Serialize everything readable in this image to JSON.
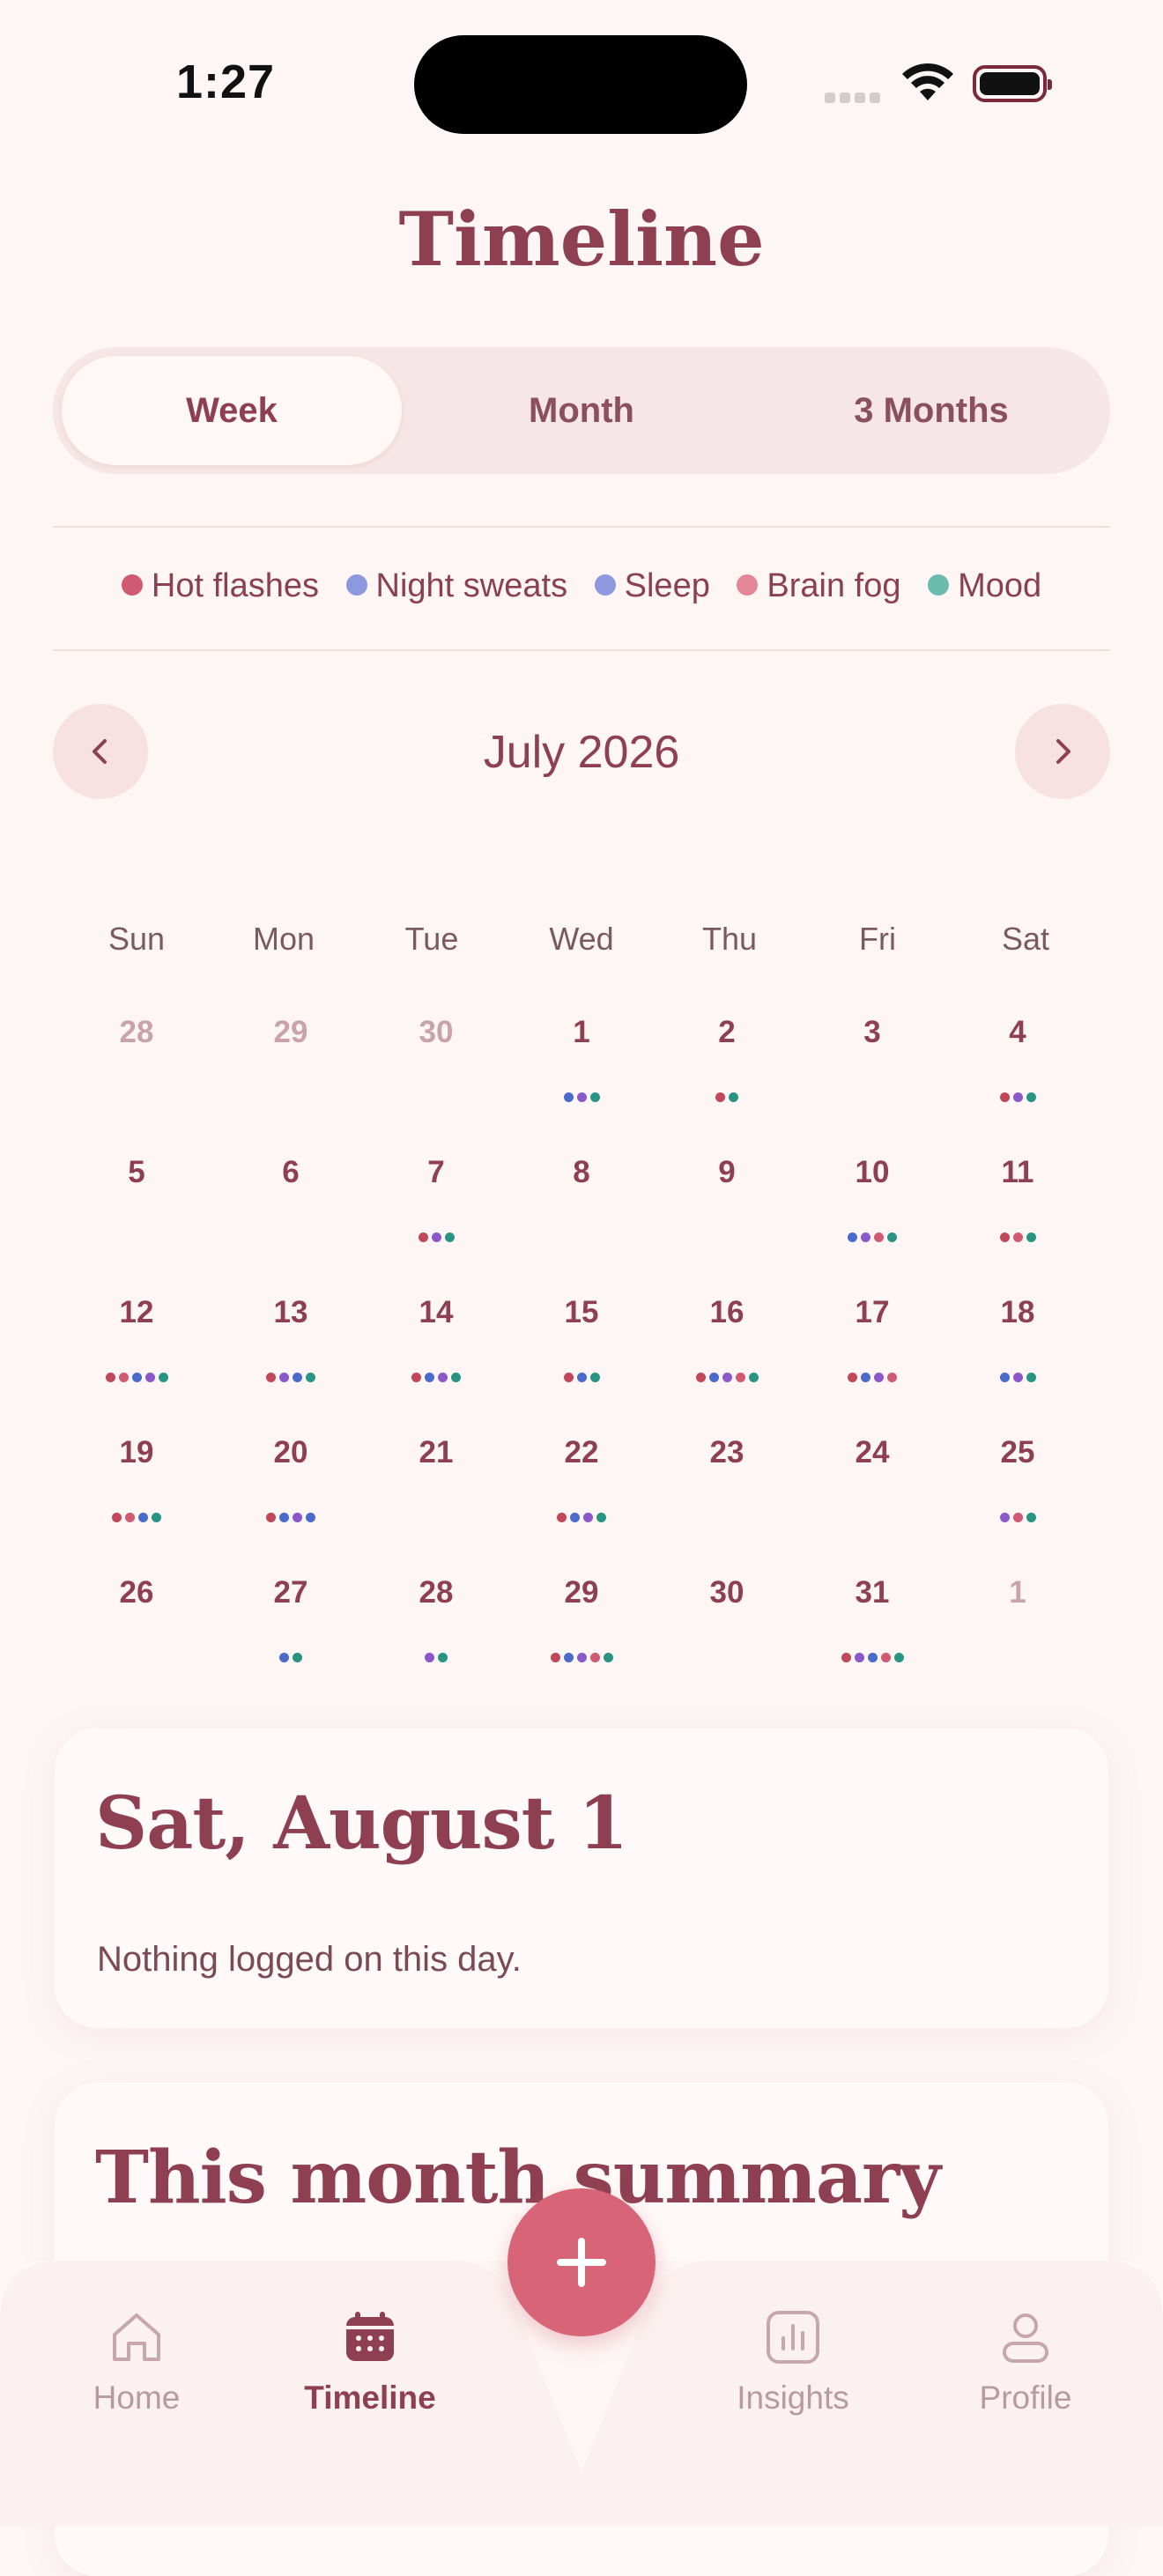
{
  "status_bar": {
    "time": "1:27"
  },
  "page": {
    "title": "Timeline"
  },
  "segments": [
    {
      "label": "Week",
      "active": true
    },
    {
      "label": "Month",
      "active": false
    },
    {
      "label": "3 Months",
      "active": false
    }
  ],
  "legend": [
    {
      "label": "Hot flashes",
      "color": "#d05a72"
    },
    {
      "label": "Night sweats",
      "color": "#8e98e0"
    },
    {
      "label": "Sleep",
      "color": "#8e98e0"
    },
    {
      "label": "Brain fog",
      "color": "#e38696"
    },
    {
      "label": "Mood",
      "color": "#6cbcae"
    }
  ],
  "symptom_colors": {
    "hf": "#c04858",
    "ns": "#4a6acc",
    "sl": "#8a58c8",
    "bf": "#d05a72",
    "md": "#2a9484"
  },
  "calendar": {
    "month_label": "July 2026",
    "weekdays": [
      "Sun",
      "Mon",
      "Tue",
      "Wed",
      "Thu",
      "Fri",
      "Sat"
    ],
    "weeks": [
      [
        {
          "d": "28",
          "m": true,
          "dots": []
        },
        {
          "d": "29",
          "m": true,
          "dots": []
        },
        {
          "d": "30",
          "m": true,
          "dots": []
        },
        {
          "d": "1",
          "dots": [
            "ns",
            "sl",
            "md"
          ]
        },
        {
          "d": "2",
          "dots": [
            "hf",
            "md"
          ]
        },
        {
          "d": "3",
          "dots": []
        },
        {
          "d": "4",
          "dots": [
            "hf",
            "sl",
            "md"
          ]
        }
      ],
      [
        {
          "d": "5",
          "dots": []
        },
        {
          "d": "6",
          "dots": []
        },
        {
          "d": "7",
          "dots": [
            "hf",
            "sl",
            "md"
          ]
        },
        {
          "d": "8",
          "dots": []
        },
        {
          "d": "9",
          "dots": []
        },
        {
          "d": "10",
          "dots": [
            "ns",
            "sl",
            "bf",
            "md"
          ]
        },
        {
          "d": "11",
          "dots": [
            "hf",
            "bf",
            "md"
          ]
        }
      ],
      [
        {
          "d": "12",
          "dots": [
            "hf",
            "bf",
            "ns",
            "sl",
            "md"
          ]
        },
        {
          "d": "13",
          "dots": [
            "hf",
            "sl",
            "ns",
            "md"
          ]
        },
        {
          "d": "14",
          "dots": [
            "hf",
            "ns",
            "sl",
            "md"
          ]
        },
        {
          "d": "15",
          "dots": [
            "hf",
            "ns",
            "md"
          ]
        },
        {
          "d": "16",
          "dots": [
            "hf",
            "ns",
            "sl",
            "bf",
            "md"
          ]
        },
        {
          "d": "17",
          "dots": [
            "hf",
            "ns",
            "sl",
            "bf"
          ]
        },
        {
          "d": "18",
          "dots": [
            "ns",
            "sl",
            "md"
          ]
        }
      ],
      [
        {
          "d": "19",
          "dots": [
            "hf",
            "bf",
            "ns",
            "md"
          ]
        },
        {
          "d": "20",
          "dots": [
            "hf",
            "ns",
            "sl",
            "ns"
          ]
        },
        {
          "d": "21",
          "dots": []
        },
        {
          "d": "22",
          "dots": [
            "hf",
            "ns",
            "sl",
            "md"
          ]
        },
        {
          "d": "23",
          "dots": []
        },
        {
          "d": "24",
          "dots": []
        },
        {
          "d": "25",
          "dots": [
            "sl",
            "bf",
            "md"
          ]
        }
      ],
      [
        {
          "d": "26",
          "dots": []
        },
        {
          "d": "27",
          "dots": [
            "ns",
            "md"
          ]
        },
        {
          "d": "28",
          "dots": [
            "sl",
            "md"
          ]
        },
        {
          "d": "29",
          "dots": [
            "hf",
            "ns",
            "sl",
            "bf",
            "md"
          ]
        },
        {
          "d": "30",
          "dots": []
        },
        {
          "d": "31",
          "dots": [
            "hf",
            "sl",
            "ns",
            "bf",
            "md"
          ]
        },
        {
          "d": "1",
          "m": true,
          "dots": []
        }
      ]
    ]
  },
  "day_card": {
    "title": "Sat, August 1",
    "message": "Nothing logged on this day."
  },
  "summary_card": {
    "title": "This month summary"
  },
  "tabbar": {
    "items": [
      {
        "label": "Home",
        "icon": "home-icon",
        "active": false
      },
      {
        "label": "Timeline",
        "icon": "calendar-icon",
        "active": true
      },
      {
        "label": "Insights",
        "icon": "chart-icon",
        "active": false
      },
      {
        "label": "Profile",
        "icon": "person-icon",
        "active": false
      }
    ],
    "add_icon": "plus-icon"
  }
}
